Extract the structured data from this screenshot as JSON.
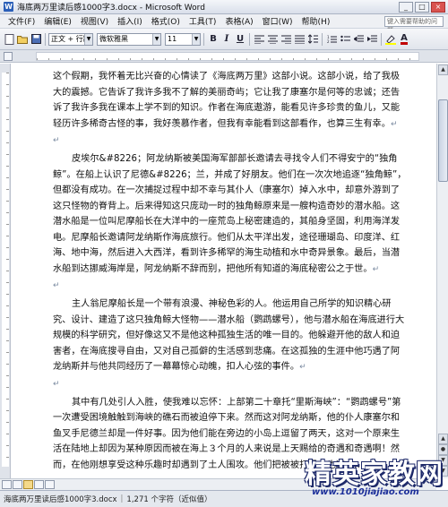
{
  "window": {
    "title": "海底两万里读后感1000字3.docx - Microsoft Word",
    "min_glyph": "_",
    "max_glyph": "□",
    "close_glyph": "×"
  },
  "menubar": {
    "items": [
      "文件(F)",
      "编辑(E)",
      "视图(V)",
      "插入(I)",
      "格式(O)",
      "工具(T)",
      "表格(A)",
      "窗口(W)",
      "帮助(H)"
    ],
    "help_placeholder": "键入需要帮助的问题"
  },
  "toolbar": {
    "style_value": "正文 + 行距",
    "font_value": "微软雅黑",
    "size_value": "11",
    "bold": "B",
    "italic": "I",
    "underline": "U",
    "font_color_label": "A",
    "accent_color": "#c00000"
  },
  "document": {
    "paragraphs": [
      "这个假期，我怀着无比兴奋的心情读了《海底两万里》这部小说。这部小说，给了我极大的震撼。它告诉了我许多我不了解的美丽奇屿；它让我了康塞尔是何等的忠诚；还告诉了我许多我在课本上学不到的知识。作者在海底遨游，能看见许多珍贵的鱼儿，又能轻历许多稀奇古怪的事，我好羡慕作者，但我有幸能看到这部看作，也算三生有幸。",
      "皮埃尔&#8226；阿龙纳斯被美国海军部部长邀请去寻找令人们不得安宁的“独角鲸”。在船上认识了尼德&#8226；兰，并成了好朋友。他们在一次次地追逐“独角鲸”，但都没有成功。在一次捕捉过程中却不幸与其仆人（康塞尔）掉入水中，却意外游到了这只怪物的脊背上。后来得知这只庞动一时的独角鲸原来是一艘构造奇妙的潜水船。这潜水船是一位叫尼摩船长在大洋中的一座荒岛上秘密建造的，其船身坚固，利用海洋发电。尼摩船长邀请阿龙纳斯作海底旅行。他们从太平洋出发，途径珊瑚岛、印度洋、红海、地中海，然后进入大西洋，看到许多稀罕的海生动植和水中奇异景象。最后，当潜水船到达挪威海岸是，阿龙纳斯不辞而别，把他所有知道的海底秘密公之于世。",
      "主人翁尼摩船长是一个带有浪漫、神秘色彩的人。他运用自己所学的知识精心研究、设计、建造了这只独角鲸大怪物——潜水船（鹦鹉螺号），他与潜水船在海底进行大规模的科学研究，但好像这又不是他这种孤独生活的唯一目的。他躲避开他的敌人和迫害者，在海底搜寻自由，又对自己孤僻的生活感到悲痛。在这孤独的生涯中他巧遇了阿龙纳斯并与他共同经历了一幕幕惊心动魄，扣人心弦的事件。",
      "其中有几处引人入胜，使我难以忘怀：上部第二十章托“里斯海峡”：“鹦鹉螺号”第一次遭受困境触触到海峡的礁石而被迫停下来。然而这对阿龙纳斯，他的仆人康塞尔和鱼叉手尼德兰却是一件好事。因为他们能在旁边的小岛上逗留了两天，这对一个原来生活在陆地上却因为某种原因而被在海上３个月的人来说是上天赐给的奇遇和奇遇啊！然而，在他刚想享受这种乐趣时却遇到了土人围攻。他们把被被打退，也遭……"
    ],
    "pilcrow": "↵"
  },
  "statusbar": {
    "filename": "海底两万里读后感1000字3.docx",
    "stats": "1,271 个字符（近似值）"
  },
  "watermark": {
    "main": "精英家教网",
    "url": "www.1010jiajiao.com"
  }
}
